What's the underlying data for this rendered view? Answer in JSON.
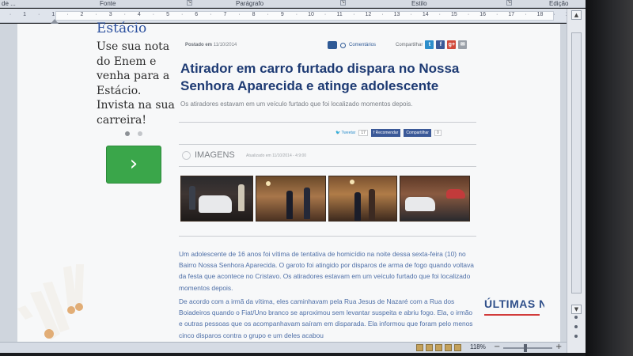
{
  "ribbon": {
    "left_label": "de ...",
    "fonte": "Fonte",
    "paragrafo": "Parágrafo",
    "estilo": "Estilo",
    "edicao": "Edição"
  },
  "ruler": {
    "ticks": [
      "·",
      "1",
      "·",
      "1",
      "·",
      "2",
      "·",
      "3",
      "·",
      "4",
      "·",
      "5",
      "·",
      "6",
      "·",
      "7",
      "·",
      "8",
      "·",
      "9",
      "·",
      "10",
      "·",
      "11",
      "·",
      "12",
      "·",
      "13",
      "·",
      "14",
      "·",
      "15",
      "·",
      "16",
      "·",
      "17",
      "·",
      "18",
      "·",
      "19"
    ]
  },
  "ad": {
    "brand": "Estácio",
    "text": "Use sua nota do Enem e venha para a Estácio. Invista na sua carreira!",
    "button_icon": "chevron-right-icon",
    "button_glyph": "›",
    "accent": "#3aa64a"
  },
  "article": {
    "meta_label": "Postado em",
    "meta_date": "11/10/2014",
    "comments_label": "Comentários",
    "share_label": "Compartilhar",
    "share_buttons": [
      {
        "name": "twitter",
        "glyph": "t",
        "color": "#2d8ecb"
      },
      {
        "name": "facebook",
        "glyph": "f",
        "color": "#3b5998"
      },
      {
        "name": "google-plus",
        "glyph": "g+",
        "color": "#d1493a"
      },
      {
        "name": "email",
        "glyph": "✉",
        "color": "#9aa0a8"
      }
    ],
    "headline": "Atirador em carro furtado dispara no Nossa Senhora Aparecida e atinge adolescente",
    "lead": "Os atiradores estavam em um veículo furtado que foi localizado momentos depois.",
    "social": {
      "tweet_label": "Tweetar",
      "tweet_count": "17",
      "recommend_label": "Recomendar",
      "share_label": "Compartilhar",
      "share_count": "0"
    },
    "gallery": {
      "title": "IMAGENS",
      "updated": "Atualizado em 11/10/2014 - 4:9:00"
    },
    "paragraphs": [
      "Um adolescente de 16 anos foi vítima de tentativa de homicídio na noite dessa sexta-feira (10) no Bairro Nossa Senhora Aparecida. O garoto foi atingido por disparos de arma de fogo quando voltava da festa que acontece no Cristavo. Os atiradores estavam em um veículo furtado que foi localizado momentos depois.",
      "De acordo com a irmã da vítima, eles caminhavam pela Rua Jesus de Nazaré com a Rua dos Boiadeiros quando o Fiat/Uno branco se aproximou sem levantar suspeita e abriu fogo. Ela, o irmão e outras pessoas que os acompanhavam saíram em disparada. Ela informou que foram pelo menos cinco disparos contra o grupo e um deles acabou"
    ]
  },
  "sidebar": {
    "heading": "ÚLTIMAS N",
    "heading_accent": "#d23b3b"
  },
  "statusbar": {
    "zoom": "118%",
    "minus": "−",
    "plus": "+",
    "zoom_level": 1.18
  },
  "scrollbar": {
    "up": "▲",
    "down": "▼"
  }
}
